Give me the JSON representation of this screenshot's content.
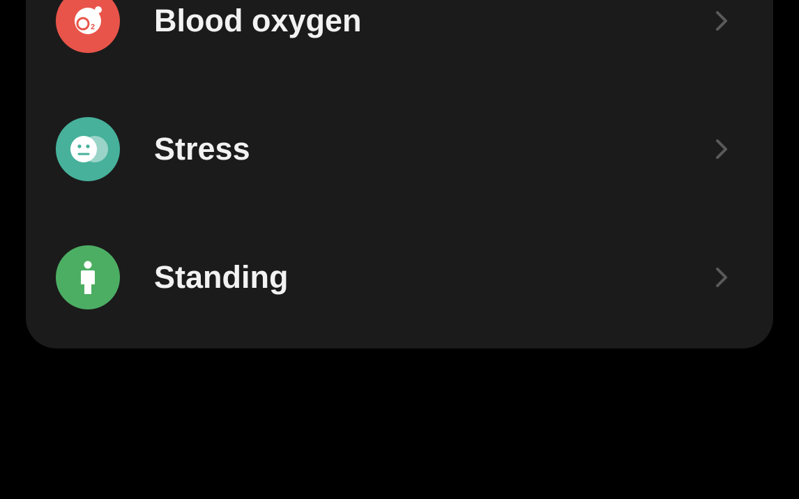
{
  "health_menu": {
    "items": [
      {
        "label": "Blood oxygen",
        "icon": "blood-oxygen-icon",
        "icon_color": "#e8544a"
      },
      {
        "label": "Stress",
        "icon": "stress-icon",
        "icon_color": "#47b19b"
      },
      {
        "label": "Standing",
        "icon": "standing-icon",
        "icon_color": "#4cae63"
      }
    ],
    "chevron_icon": "chevron-right-icon",
    "colors": {
      "background": "#000000",
      "card": "#1b1b1b",
      "text": "#f2f2f2",
      "chevron": "#5a5a5a"
    }
  }
}
